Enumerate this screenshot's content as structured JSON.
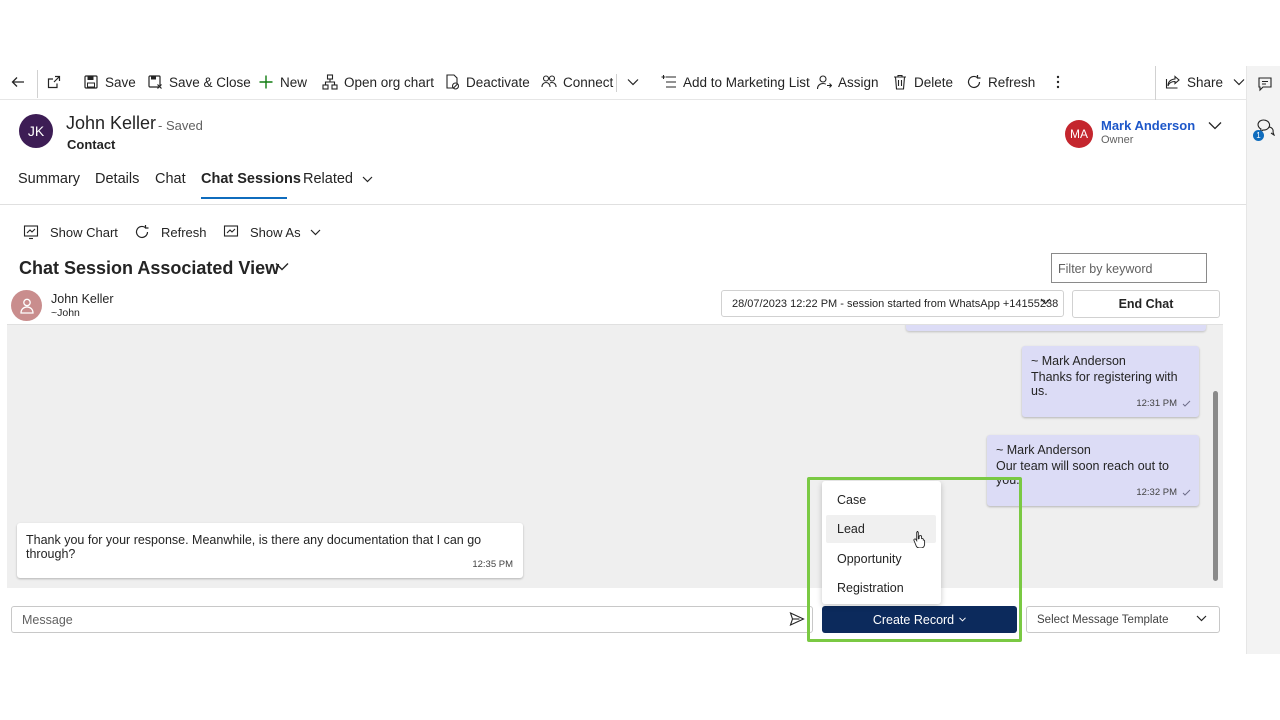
{
  "commandbar": {
    "save": "Save",
    "save_close": "Save & Close",
    "new": "New",
    "open_org_chart": "Open org chart",
    "deactivate": "Deactivate",
    "connect": "Connect",
    "add_marketing": "Add to Marketing List",
    "assign": "Assign",
    "delete": "Delete",
    "refresh": "Refresh",
    "share": "Share"
  },
  "rail": {
    "badge": "1"
  },
  "record": {
    "initials": "JK",
    "name": "John Keller",
    "saved_state": "- Saved",
    "entity": "Contact",
    "owner_initials": "MA",
    "owner_name": "Mark Anderson",
    "owner_label": "Owner"
  },
  "tabs": [
    {
      "label": "Summary"
    },
    {
      "label": "Details"
    },
    {
      "label": "Chat"
    },
    {
      "label": "Chat Sessions",
      "active": true
    },
    {
      "label": "Related"
    }
  ],
  "subgrid": {
    "show_chart": "Show Chart",
    "refresh": "Refresh",
    "show_as": "Show As",
    "view_title": "Chat Session Associated View",
    "filter_placeholder": "Filter by keyword"
  },
  "chat": {
    "user_name": "John Keller",
    "user_handle": "~John",
    "session": "28/07/2023 12:22 PM - session started from WhatsApp +14155238",
    "end_chat": "End Chat",
    "messages": [
      {
        "direction": "out",
        "sender": "~ Mark Anderson",
        "text": "Thanks for registering with us.",
        "time": "12:31 PM"
      },
      {
        "direction": "out",
        "sender": "~ Mark Anderson",
        "text": "Our team will soon reach out to you.",
        "time": "12:32 PM"
      },
      {
        "direction": "in",
        "text": "Thank you for your response. Meanwhile, is there any documentation that I can go through?",
        "time": "12:35 PM"
      }
    ],
    "message_placeholder": "Message",
    "create_record": "Create Record",
    "template_placeholder": "Select Message Template",
    "record_menu": [
      "Case",
      "Lead",
      "Opportunity",
      "Registration"
    ]
  },
  "colors": {
    "accent": "#0f6cbd",
    "create_record_bg": "#0c2a5c",
    "outgoing_bubble": "#dcdcf6",
    "highlight": "#7ac943",
    "owner_avatar": "#c4262e",
    "contact_avatar": "#3d1d55"
  }
}
